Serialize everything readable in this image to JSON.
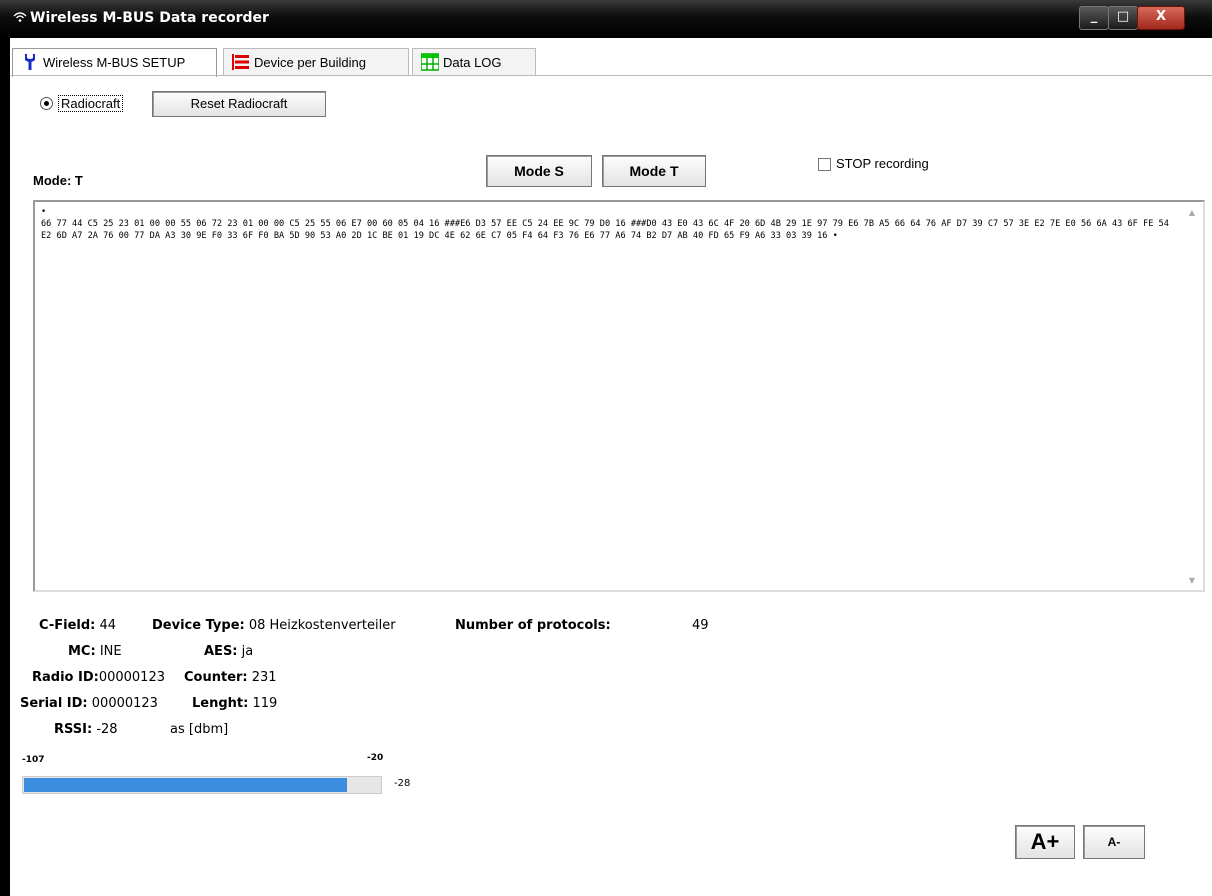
{
  "window": {
    "title": "Wireless M-BUS Data recorder",
    "minimize": "_",
    "maximize": "□",
    "close": "X"
  },
  "tabs": [
    {
      "label": "Wireless M-BUS SETUP",
      "icon": "wrench-icon",
      "icon_color": "#1a2cc8",
      "active": true
    },
    {
      "label": "Device per Building",
      "icon": "list-icon",
      "icon_color": "#e00000",
      "active": false
    },
    {
      "label": "Data LOG",
      "icon": "grid-icon",
      "icon_color": "#00c800",
      "active": false
    }
  ],
  "setup": {
    "radio_label": "Radiocraft",
    "reset_button": "Reset Radiocraft",
    "mode_s_button": "Mode S",
    "mode_t_button": "Mode T",
    "stop_recording_label": "STOP recording",
    "mode_title": "Mode: T",
    "hex_output": "•\n66 77 44 C5 25 23 01 00 00 55 06 72 23 01 00 00 C5 25 55 06 E7 00 60 05 04 16 ###E6 D3 57 EE C5 24 EE 9C 79 D0 16 ###D0 43 E0 43 6C 4F 20 6D 4B 29 1E 97 79 E6 7B A5 66 64 76 AF D7 39 C7 57 3E E2 7E E0 56 6A 43 6F FE 54 E2 6D A7 2A 76 00 77 DA A3 30 9E F0 33 6F F0 BA 5D 90 53 A0 2D 1C BE 01 19 DC 4E 62 6E C7 05 F4 64 F3 76 E6 77 A6 74 B2 D7 AB 40 FD 65 F9 A6 33 03 39 16 •"
  },
  "info": {
    "c_field_label": "C-Field:",
    "c_field_value": "44",
    "device_type_label": "Device Type:",
    "device_type_value": "08 Heizkostenverteiler",
    "protocols_label": "Number of protocols:",
    "protocols_value": "49",
    "mc_label": "MC:",
    "mc_value": "INE",
    "aes_label": "AES:",
    "aes_value": "ja",
    "radio_id_label": "Radio ID:",
    "radio_id_value": "00000123",
    "counter_label": "Counter:",
    "counter_value": "231",
    "serial_id_label": "Serial ID:",
    "serial_id_value": "00000123",
    "length_label": "Lenght:",
    "length_value": "119",
    "rssi_label": "RSSI:",
    "rssi_value": "-28",
    "rssi_unit": "as [dbm]"
  },
  "rssi_bar": {
    "min_label": "-107",
    "max_label": "-20",
    "min": -107,
    "max": -20,
    "value": -28,
    "value_label": "-28",
    "color": "#3d8ee0"
  },
  "font_buttons": {
    "increase": "A+",
    "decrease": "A-"
  }
}
